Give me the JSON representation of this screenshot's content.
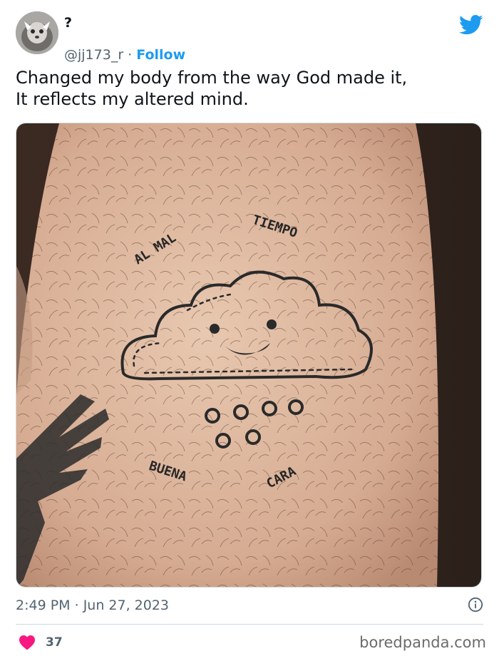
{
  "author": {
    "display_name": "?",
    "handle": "@jj173_r",
    "separator": " · ",
    "follow_label": "Follow"
  },
  "tweet": {
    "line1": "Changed my body from the way God made it,",
    "line2": "It reflects my altered mind."
  },
  "tattoo_text": {
    "top_left": "AL MAL",
    "top_right": "TIEMPO",
    "bottom_left": "BUENA",
    "bottom_right": "CARA"
  },
  "meta": {
    "time": "2:49 PM",
    "separator": " · ",
    "date": "Jun 27, 2023"
  },
  "engagement": {
    "likes": "37"
  },
  "watermark": "boredpanda.com",
  "colors": {
    "accent": "#1d9bf0",
    "like": "#f91880",
    "secondary_text": "#536471"
  },
  "icons": {
    "brand": "twitter-bird-icon",
    "info": "info-icon",
    "like": "heart-icon"
  }
}
